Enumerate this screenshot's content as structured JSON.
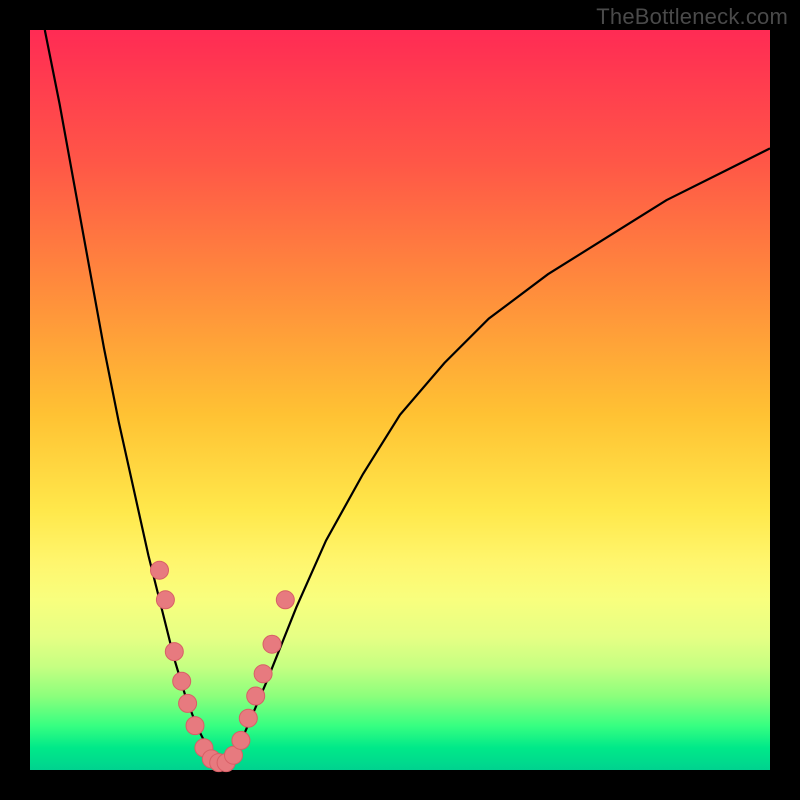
{
  "watermark": "TheBottleneck.com",
  "colors": {
    "frame": "#000000",
    "curve": "#000000",
    "marker_fill": "#e77a7f",
    "marker_stroke": "#d85f66"
  },
  "chart_data": {
    "type": "line",
    "title": "",
    "xlabel": "",
    "ylabel": "",
    "xlim": [
      0,
      100
    ],
    "ylim": [
      0,
      100
    ],
    "grid": false,
    "legend": false,
    "note": "Values estimated from pixel positions; y measured upward from plot bottom.",
    "curve_left": {
      "x": [
        2,
        4,
        6,
        8,
        10,
        12,
        14,
        16,
        18,
        19.5,
        21,
        22.5,
        24,
        25
      ],
      "y": [
        100,
        90,
        79,
        68,
        57,
        47,
        38,
        29,
        21,
        15,
        10,
        6,
        3,
        1
      ]
    },
    "curve_right": {
      "x": [
        27,
        29,
        32,
        36,
        40,
        45,
        50,
        56,
        62,
        70,
        78,
        86,
        94,
        100
      ],
      "y": [
        1,
        5,
        12,
        22,
        31,
        40,
        48,
        55,
        61,
        67,
        72,
        77,
        81,
        84
      ]
    },
    "markers": [
      {
        "x": 17.5,
        "y": 27
      },
      {
        "x": 18.3,
        "y": 23
      },
      {
        "x": 19.5,
        "y": 16
      },
      {
        "x": 20.5,
        "y": 12
      },
      {
        "x": 21.3,
        "y": 9
      },
      {
        "x": 22.3,
        "y": 6
      },
      {
        "x": 23.5,
        "y": 3
      },
      {
        "x": 24.5,
        "y": 1.5
      },
      {
        "x": 25.5,
        "y": 1
      },
      {
        "x": 26.5,
        "y": 1
      },
      {
        "x": 27.5,
        "y": 2
      },
      {
        "x": 28.5,
        "y": 4
      },
      {
        "x": 29.5,
        "y": 7
      },
      {
        "x": 30.5,
        "y": 10
      },
      {
        "x": 31.5,
        "y": 13
      },
      {
        "x": 32.7,
        "y": 17
      },
      {
        "x": 34.5,
        "y": 23
      }
    ]
  }
}
